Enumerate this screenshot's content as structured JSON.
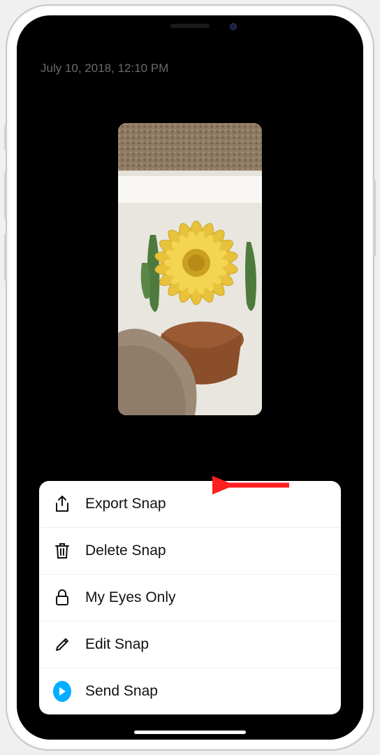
{
  "timestamp": "July 10, 2018, 12:10 PM",
  "menu": {
    "items": [
      {
        "label": "Export Snap",
        "icon": "share-icon"
      },
      {
        "label": "Delete Snap",
        "icon": "trash-icon"
      },
      {
        "label": "My Eyes Only",
        "icon": "lock-icon"
      },
      {
        "label": "Edit Snap",
        "icon": "pencil-icon"
      },
      {
        "label": "Send Snap",
        "icon": "send-icon"
      }
    ]
  },
  "annotation": {
    "arrow_target": "export-snap"
  }
}
